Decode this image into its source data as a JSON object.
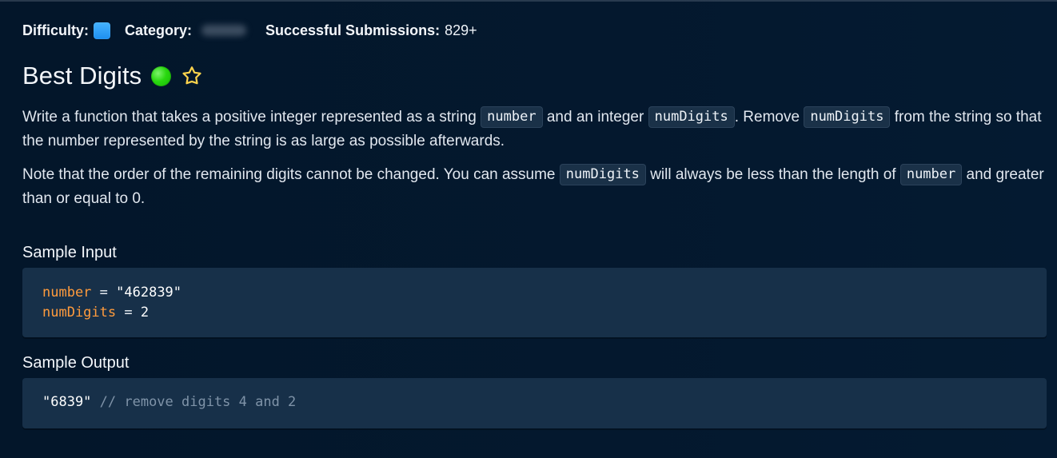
{
  "meta": {
    "difficulty_label": "Difficulty:",
    "category_label": "Category:",
    "submissions_label": "Successful Submissions:",
    "submissions_value": "829+"
  },
  "question": {
    "title": "Best Digits"
  },
  "description": {
    "p1": {
      "part1": "Write a function that takes a positive integer represented as a string ",
      "code1": "number",
      "part2": " and an integer ",
      "code2": "numDigits",
      "part3": ". Remove ",
      "code3": "numDigits",
      "part4": " from the string so that the number represented by the string is as large as possible afterwards."
    },
    "p2": {
      "part1": "Note that the order of the remaining digits cannot be changed. You can assume ",
      "code1": "numDigits",
      "part2": " will always be less than the length of ",
      "code2": "number",
      "part3": " and greater than or equal to 0."
    }
  },
  "sample_input": {
    "label": "Sample Input",
    "line1_var": "number",
    "line1_eq": " = ",
    "line1_val": "\"462839\"",
    "line2_var": "numDigits",
    "line2_eq": " = ",
    "line2_val": "2"
  },
  "sample_output": {
    "label": "Sample Output",
    "value": "\"6839\"",
    "comment": " // remove digits 4 and 2"
  },
  "colors": {
    "background": "#03162a",
    "code_background": "#173049",
    "accent_blue": "#1d8ff0",
    "status_green": "#29d80f",
    "variable_orange": "#ff9b3d",
    "star_yellow": "#ffd44d"
  },
  "icons": {
    "difficulty": "difficulty-badge-icon",
    "status": "completed-status-icon",
    "favorite": "star-icon"
  }
}
